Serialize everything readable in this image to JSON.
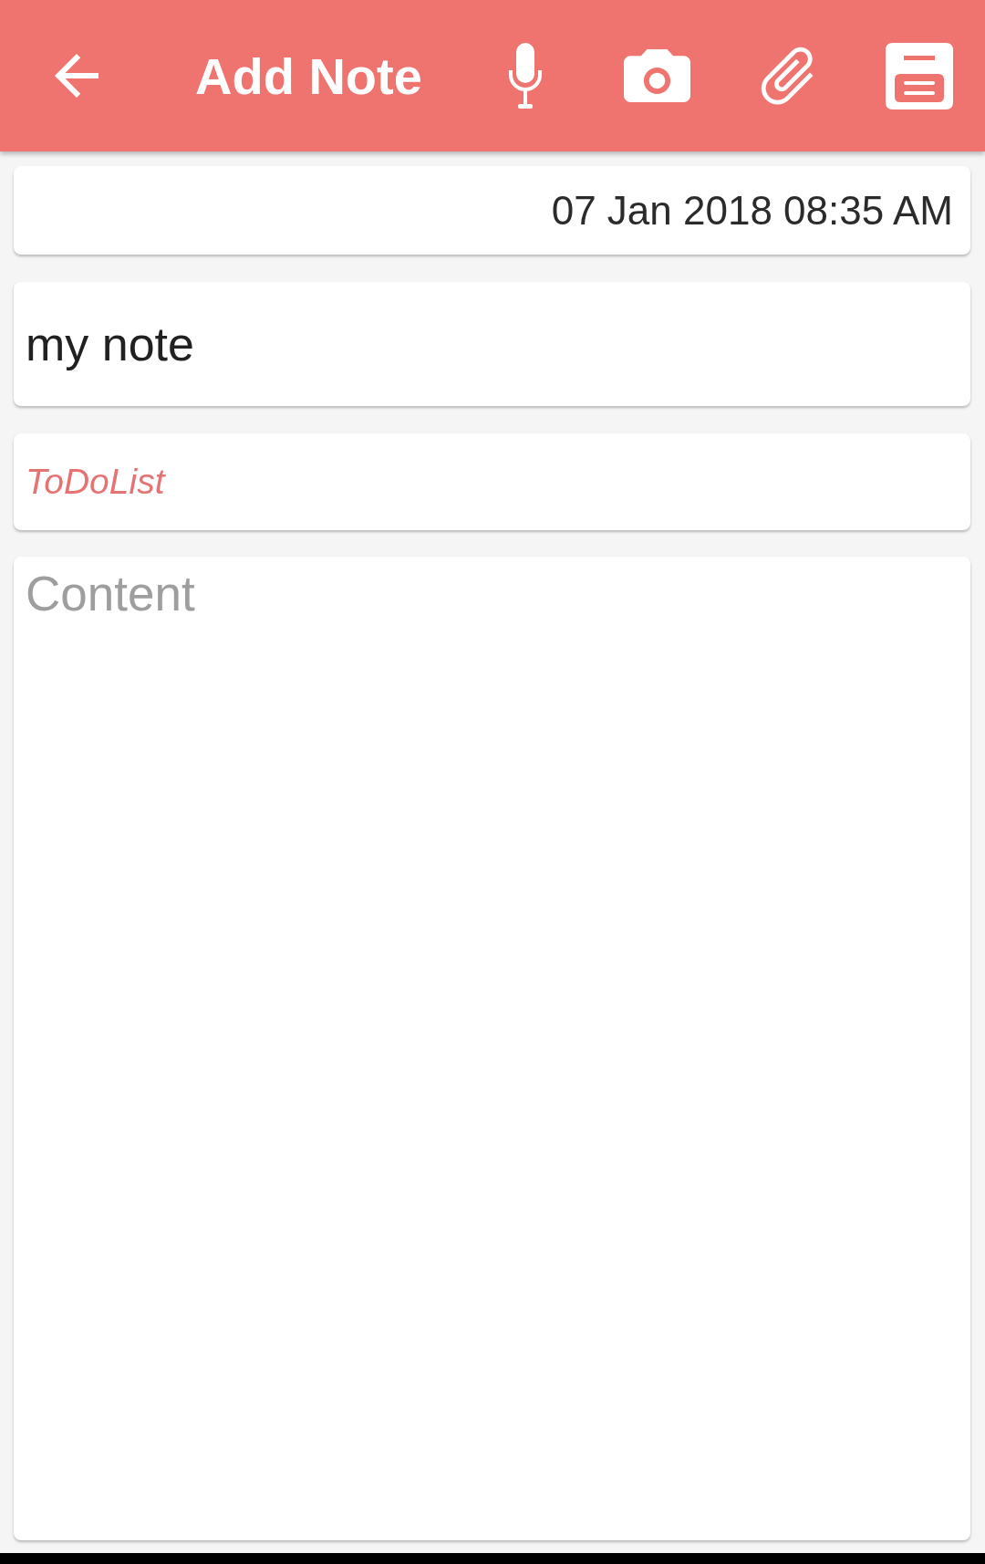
{
  "toolbar": {
    "title": "Add Note"
  },
  "date": {
    "value": "07 Jan 2018 08:35 AM"
  },
  "title_field": {
    "value": "my note"
  },
  "category": {
    "value": "ToDoList"
  },
  "content": {
    "placeholder": "Content"
  }
}
